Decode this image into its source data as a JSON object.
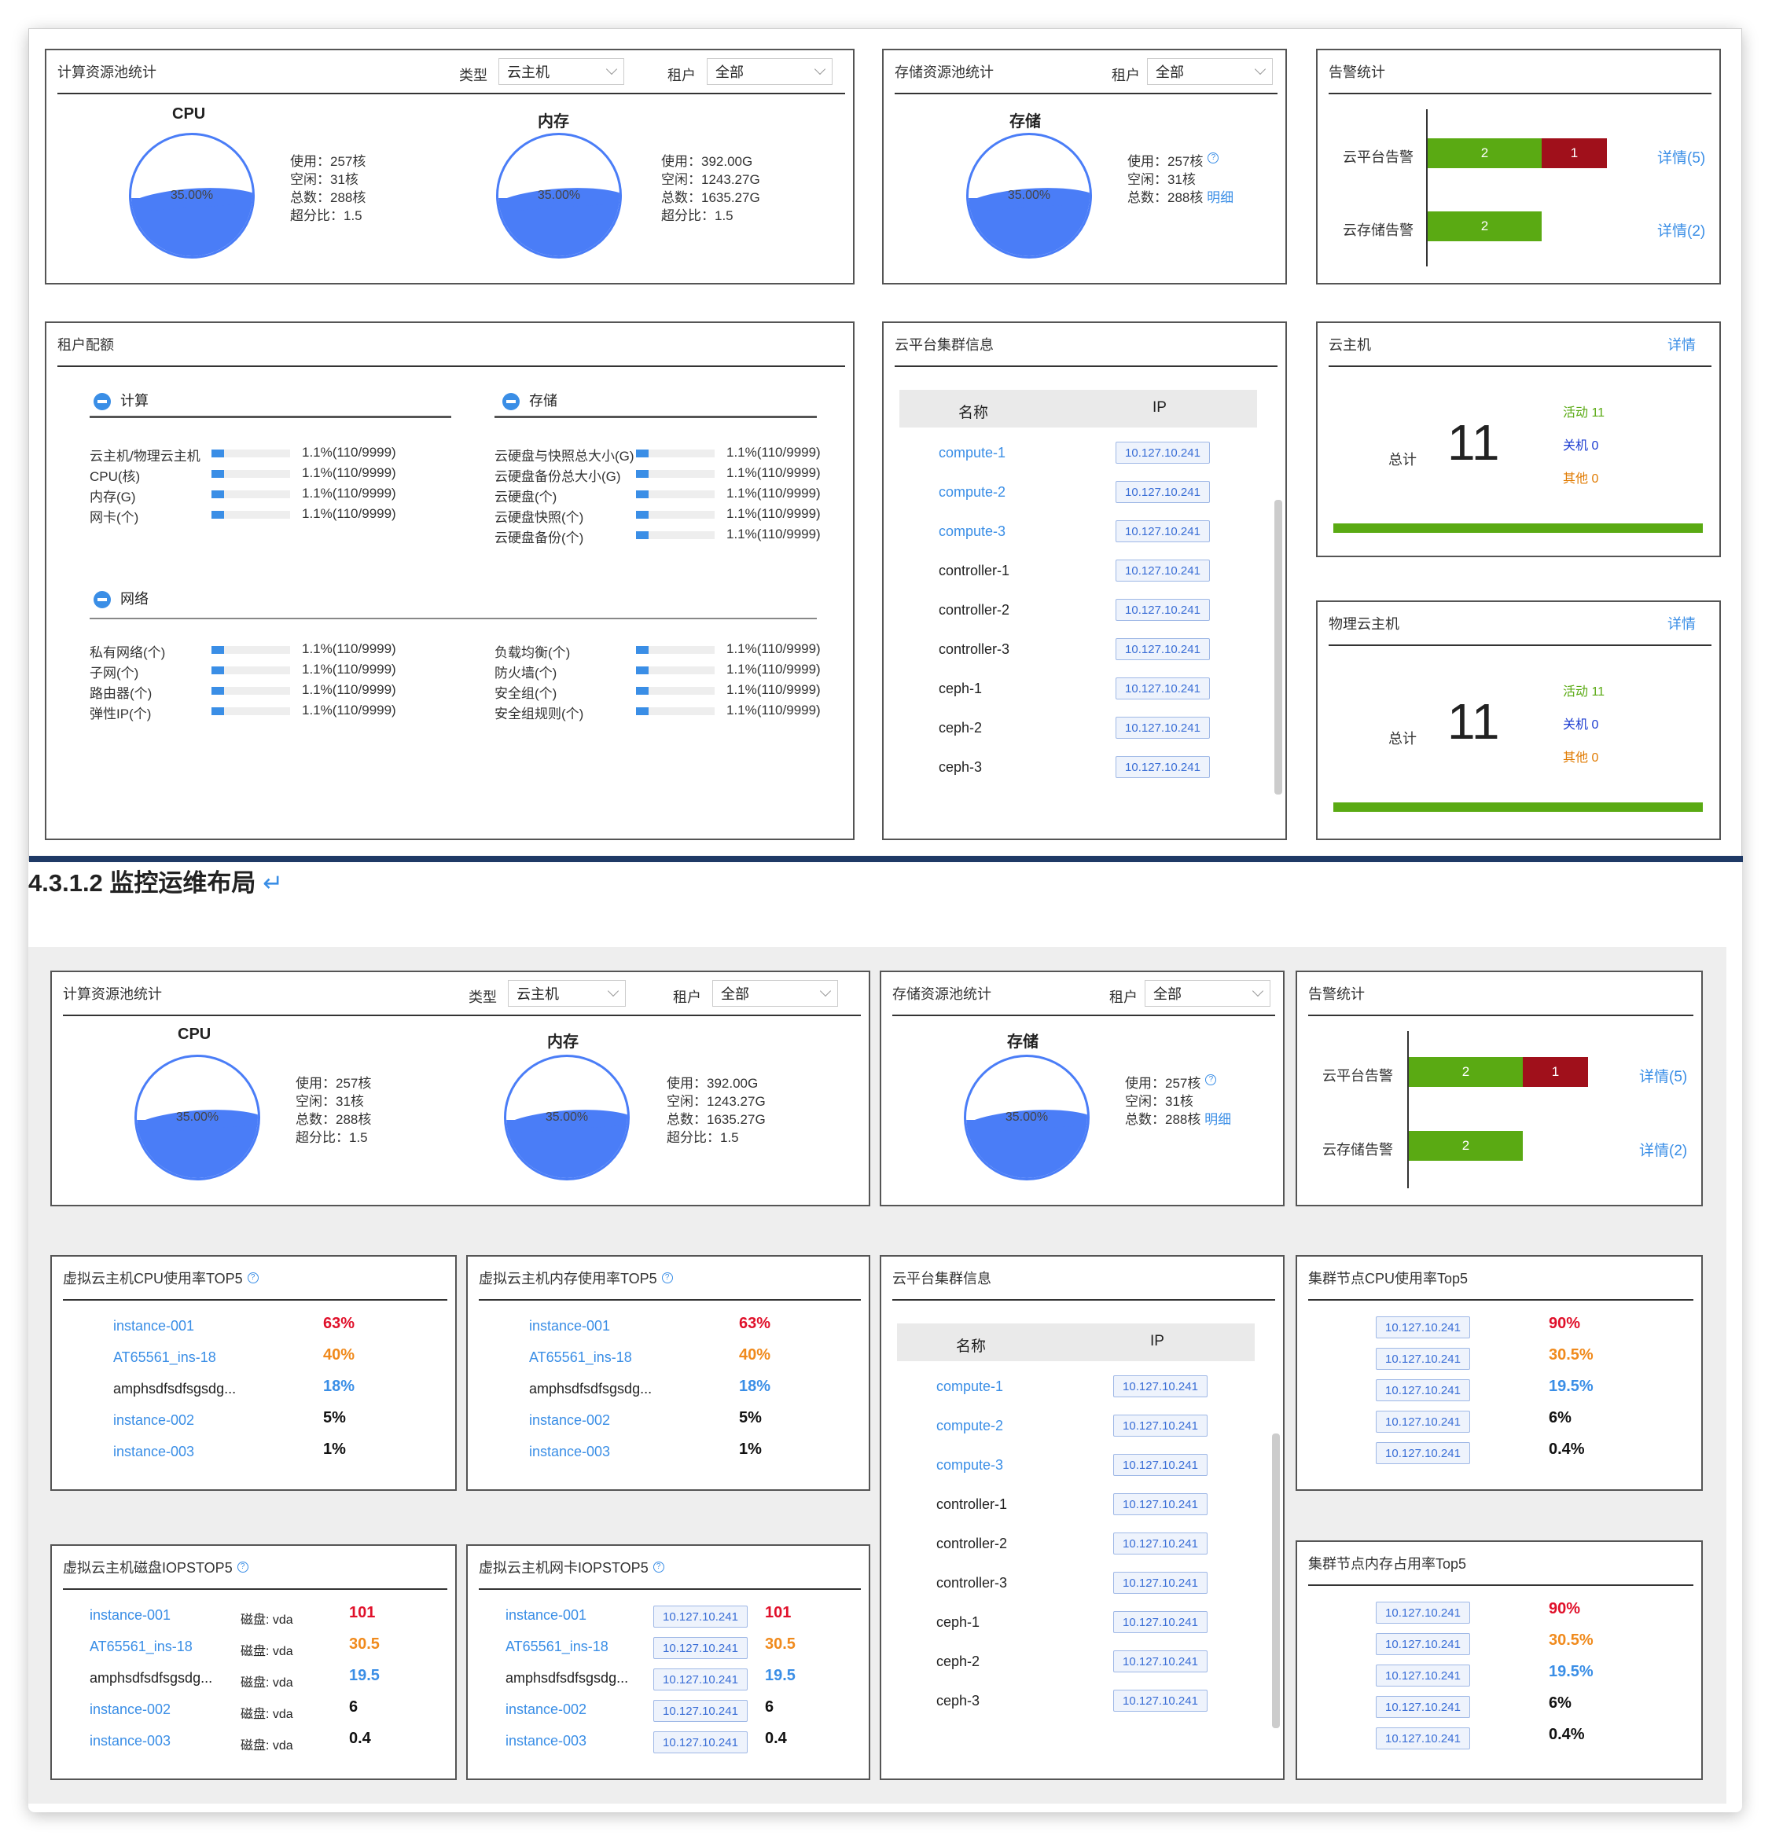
{
  "top": {
    "compute": {
      "title": "计算资源池统计",
      "type_label": "类型",
      "type_value": "云主机",
      "tenant_label": "租户",
      "tenant_value": "全部",
      "cpu": {
        "title": "CPU",
        "pct": "35.00%",
        "lines": [
          "使用：257核",
          "空闲：31核",
          "总数：288核",
          "超分比：1.5"
        ]
      },
      "mem": {
        "title": "内存",
        "pct": "35.00%",
        "lines": [
          "使用：392.00G",
          "空闲：1243.27G",
          "总数：1635.27G",
          "超分比：1.5"
        ]
      }
    },
    "storage": {
      "title": "存储资源池统计",
      "tenant_label": "租户",
      "tenant_value": "全部",
      "name": "存储",
      "pct": "35.00%",
      "lines": [
        "使用：257核",
        "空闲：31核",
        "总数：288核"
      ],
      "detail": "明细"
    },
    "alarm": {
      "title": "告警统计",
      "rows": [
        {
          "label": "云平台告警",
          "a": "2",
          "b": "1",
          "link": "详情(5)"
        },
        {
          "label": "云存储告警",
          "a": "2",
          "link": "详情(2)"
        }
      ]
    },
    "quota": {
      "title": "租户配额",
      "compute": "计算",
      "storage": "存储",
      "network": "网络",
      "compute_rows": [
        "云主机/物理云主机",
        "CPU(核)",
        "内存(G)",
        "网卡(个)"
      ],
      "storage_rows": [
        "云硬盘与快照总大小(G)",
        "云硬盘备份总大小(G)",
        "云硬盘(个)",
        "云硬盘快照(个)",
        "云硬盘备份(个)"
      ],
      "net_left": [
        "私有网络(个)",
        "子网(个)",
        "路由器(个)",
        "弹性IP(个)"
      ],
      "net_right": [
        "负载均衡(个)",
        "防火墙(个)",
        "安全组(个)",
        "安全组规则(个)"
      ],
      "value": "1.1%(110/9999)",
      "fill": 0.011
    },
    "cluster": {
      "title": "云平台集群信息",
      "col_name": "名称",
      "col_ip": "IP",
      "rows": [
        {
          "n": "compute-1",
          "ip": "10.127.10.241",
          "link": true
        },
        {
          "n": "compute-2",
          "ip": "10.127.10.241",
          "link": true
        },
        {
          "n": "compute-3",
          "ip": "10.127.10.241",
          "link": true
        },
        {
          "n": "controller-1",
          "ip": "10.127.10.241"
        },
        {
          "n": "controller-2",
          "ip": "10.127.10.241"
        },
        {
          "n": "controller-3",
          "ip": "10.127.10.241"
        },
        {
          "n": "ceph-1",
          "ip": "10.127.10.241"
        },
        {
          "n": "ceph-2",
          "ip": "10.127.10.241"
        },
        {
          "n": "ceph-3",
          "ip": "10.127.10.241"
        }
      ]
    },
    "vm": {
      "title": "云主机",
      "detail": "详情",
      "total_label": "总计",
      "total": "11",
      "active": "活动 11",
      "off": "关机 0",
      "other": "其他 0"
    },
    "pvm": {
      "title": "物理云主机",
      "detail": "详情",
      "total_label": "总计",
      "total": "11",
      "active": "活动 11",
      "off": "关机 0",
      "other": "其他 0"
    }
  },
  "heading": "4.3.1.2 监控运维布局",
  "bottom": {
    "cpu_top5": {
      "title": "虚拟云主机CPU使用率TOP5"
    },
    "mem_top5": {
      "title": "虚拟云主机内存使用率TOP5"
    },
    "disk_top5": {
      "title": "虚拟云主机磁盘IOPSTOP5",
      "disk": "磁盘: vda"
    },
    "nic_top5": {
      "title": "虚拟云主机网卡IOPSTOP5",
      "ip": "10.127.10.241"
    },
    "node_cpu": {
      "title": "集群节点CPU使用率Top5"
    },
    "node_mem": {
      "title": "集群节点内存占用率Top5"
    },
    "names": [
      "instance-001",
      "AT65561_ins-18",
      "amphsdfsdfsgsdg...",
      "instance-002",
      "instance-003"
    ],
    "pcts": [
      "63%",
      "40%",
      "18%",
      "5%",
      "1%"
    ],
    "iops": [
      "101",
      "30.5",
      "19.5",
      "6",
      "0.4"
    ],
    "node_pcts": [
      "90%",
      "30.5%",
      "19.5%",
      "6%",
      "0.4%"
    ],
    "node_ip": "10.127.10.241"
  }
}
